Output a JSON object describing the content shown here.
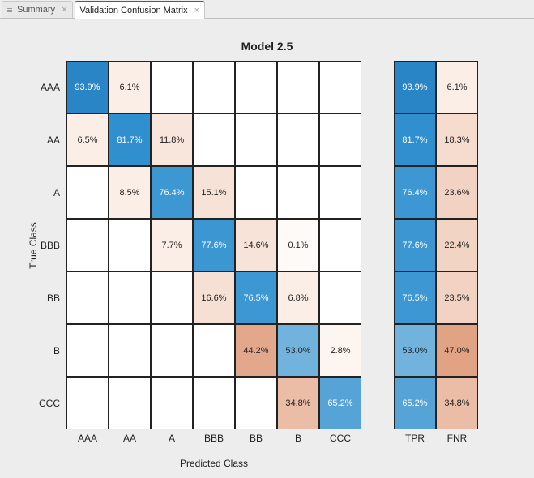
{
  "tabs": {
    "summary": "Summary",
    "matrix": "Validation Confusion Matrix"
  },
  "chart": {
    "title": "Model 2.5",
    "ylabel": "True Class",
    "xlabel": "Predicted Class"
  },
  "chart_data": {
    "type": "heatmap",
    "classes": [
      "AAA",
      "AA",
      "A",
      "BBB",
      "BB",
      "B",
      "CCC"
    ],
    "side_columns": [
      "TPR",
      "FNR"
    ],
    "matrix": [
      {
        "r": 0,
        "c": 0,
        "v": "93.9%",
        "bg": "#2a85c7",
        "wt": true
      },
      {
        "r": 0,
        "c": 1,
        "v": "6.1%",
        "bg": "#fbeee6"
      },
      {
        "r": 1,
        "c": 0,
        "v": "6.5%",
        "bg": "#fbeee6"
      },
      {
        "r": 1,
        "c": 1,
        "v": "81.7%",
        "bg": "#308fcf",
        "wt": true
      },
      {
        "r": 1,
        "c": 2,
        "v": "11.8%",
        "bg": "#f8e5db"
      },
      {
        "r": 2,
        "c": 1,
        "v": "8.5%",
        "bg": "#fbeee6"
      },
      {
        "r": 2,
        "c": 2,
        "v": "76.4%",
        "bg": "#3d97d2",
        "wt": true
      },
      {
        "r": 2,
        "c": 3,
        "v": "15.1%",
        "bg": "#f7e2d7"
      },
      {
        "r": 3,
        "c": 2,
        "v": "7.7%",
        "bg": "#fbeee6"
      },
      {
        "r": 3,
        "c": 3,
        "v": "77.6%",
        "bg": "#3b96d2",
        "wt": true
      },
      {
        "r": 3,
        "c": 4,
        "v": "14.6%",
        "bg": "#f7e3d8"
      },
      {
        "r": 3,
        "c": 5,
        "v": "0.1%",
        "bg": "#fefaf7"
      },
      {
        "r": 4,
        "c": 3,
        "v": "16.6%",
        "bg": "#f6e0d4"
      },
      {
        "r": 4,
        "c": 4,
        "v": "76.5%",
        "bg": "#3d97d2",
        "wt": true
      },
      {
        "r": 4,
        "c": 5,
        "v": "6.8%",
        "bg": "#fbeee6"
      },
      {
        "r": 5,
        "c": 4,
        "v": "44.2%",
        "bg": "#e3a88b"
      },
      {
        "r": 5,
        "c": 5,
        "v": "53.0%",
        "bg": "#72b3dd"
      },
      {
        "r": 5,
        "c": 6,
        "v": "2.8%",
        "bg": "#fdf5f0"
      },
      {
        "r": 6,
        "c": 5,
        "v": "34.8%",
        "bg": "#ebbda6"
      },
      {
        "r": 6,
        "c": 6,
        "v": "65.2%",
        "bg": "#56a4d7",
        "wt": true
      }
    ],
    "side": [
      {
        "r": 0,
        "c": 0,
        "v": "93.9%",
        "bg": "#2a85c7",
        "wt": true
      },
      {
        "r": 0,
        "c": 1,
        "v": "6.1%",
        "bg": "#fbeee6"
      },
      {
        "r": 1,
        "c": 0,
        "v": "81.7%",
        "bg": "#308fcf",
        "wt": true
      },
      {
        "r": 1,
        "c": 1,
        "v": "18.3%",
        "bg": "#f5dccf"
      },
      {
        "r": 2,
        "c": 0,
        "v": "76.4%",
        "bg": "#3d97d2",
        "wt": true
      },
      {
        "r": 2,
        "c": 1,
        "v": "23.6%",
        "bg": "#f2d2c2"
      },
      {
        "r": 3,
        "c": 0,
        "v": "77.6%",
        "bg": "#3b96d2",
        "wt": true
      },
      {
        "r": 3,
        "c": 1,
        "v": "22.4%",
        "bg": "#f2d4c4"
      },
      {
        "r": 4,
        "c": 0,
        "v": "76.5%",
        "bg": "#3d97d2",
        "wt": true
      },
      {
        "r": 4,
        "c": 1,
        "v": "23.5%",
        "bg": "#f2d2c2"
      },
      {
        "r": 5,
        "c": 0,
        "v": "53.0%",
        "bg": "#72b3dd"
      },
      {
        "r": 5,
        "c": 1,
        "v": "47.0%",
        "bg": "#e2a385"
      },
      {
        "r": 6,
        "c": 0,
        "v": "65.2%",
        "bg": "#56a4d7",
        "wt": true
      },
      {
        "r": 6,
        "c": 1,
        "v": "34.8%",
        "bg": "#ebbda6"
      }
    ]
  }
}
